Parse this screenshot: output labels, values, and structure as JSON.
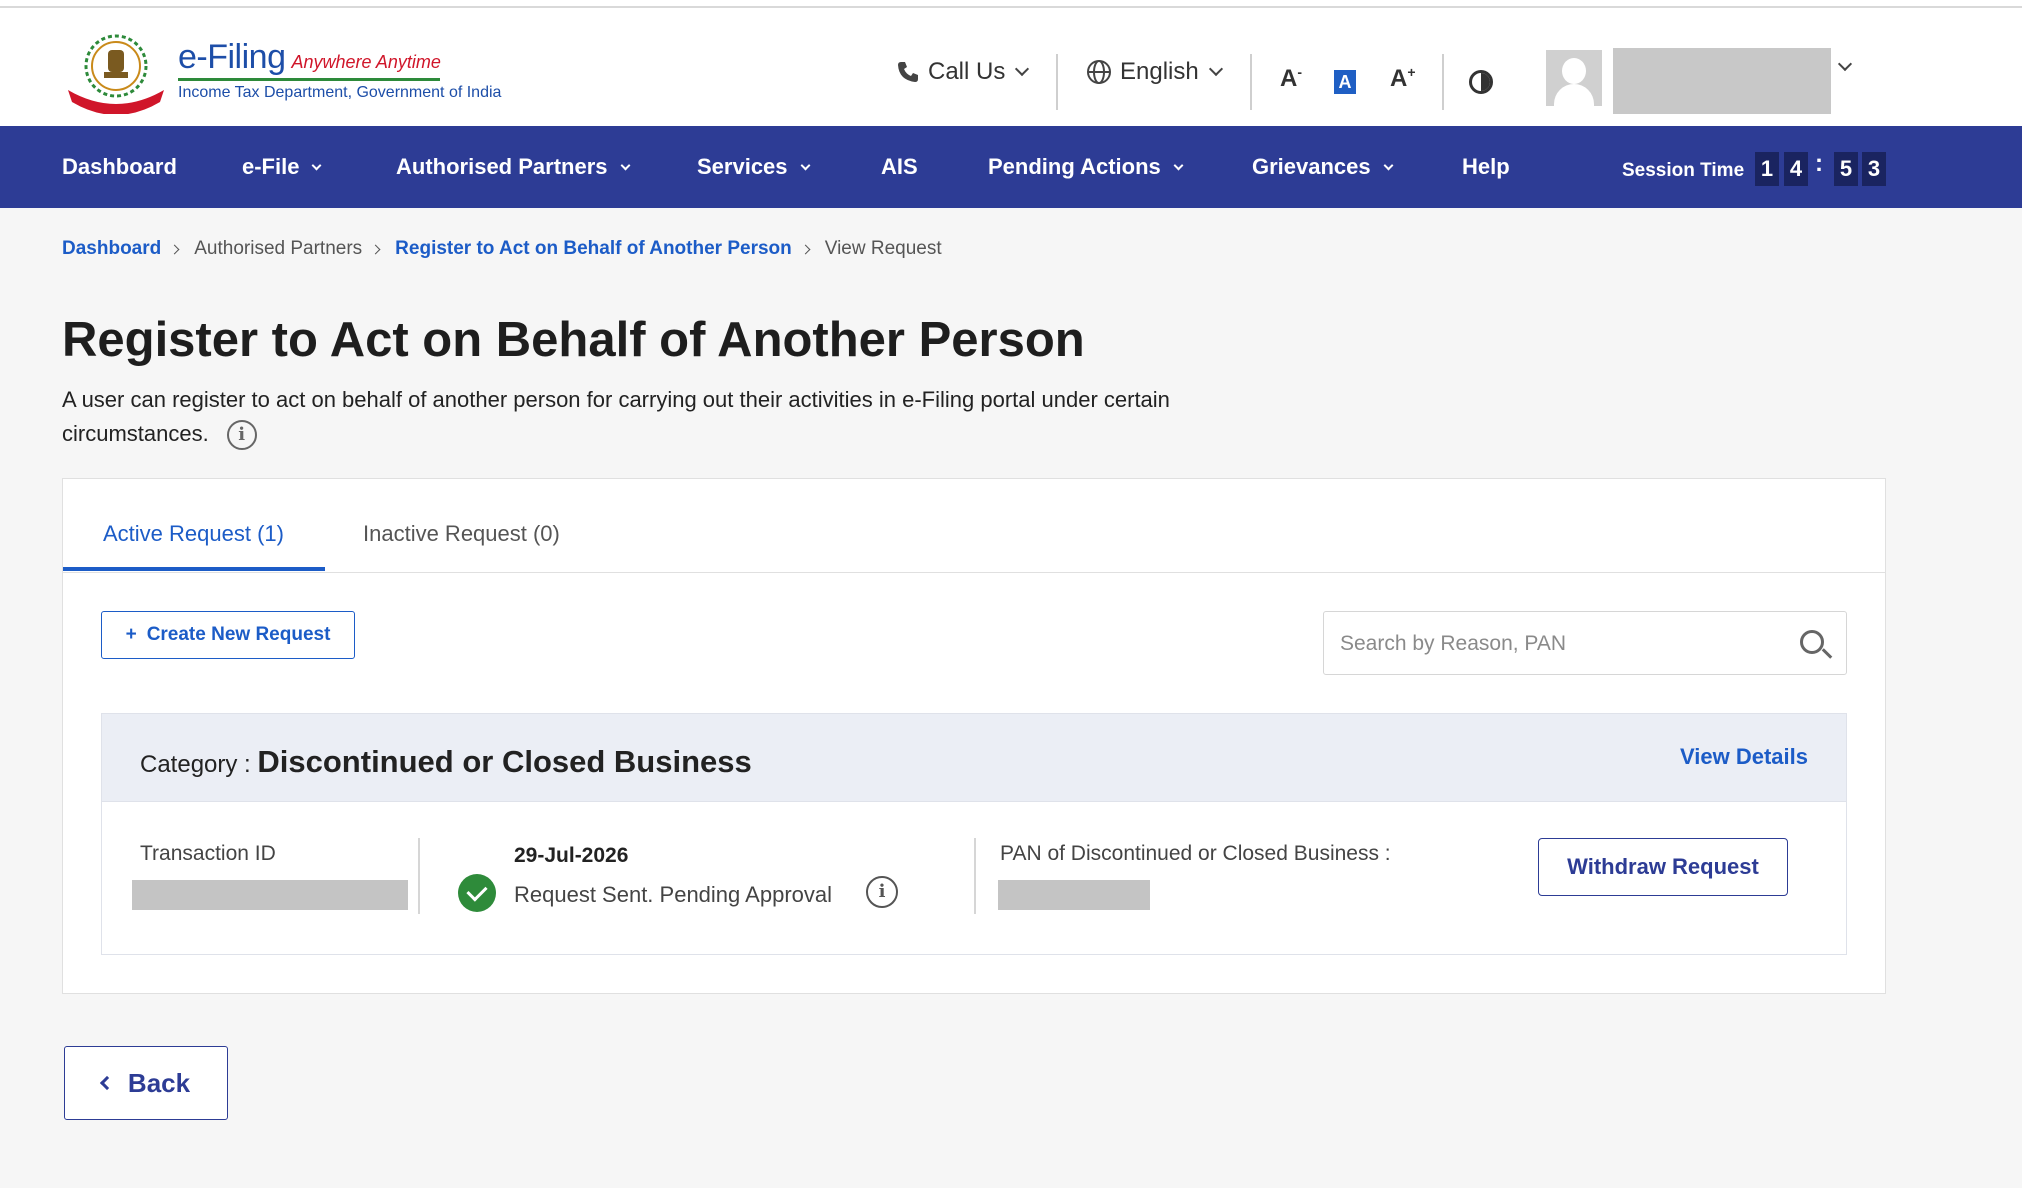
{
  "header": {
    "logo_title": "e-Filing",
    "logo_tagline": "Anywhere Anytime",
    "logo_subtitle": "Income Tax Department, Government of India",
    "call_us": "Call Us",
    "language": "English",
    "font_decrease": "A",
    "font_normal": "A",
    "font_increase": "A"
  },
  "nav": {
    "items": [
      {
        "label": "Dashboard"
      },
      {
        "label": "e-File"
      },
      {
        "label": "Authorised Partners"
      },
      {
        "label": "Services"
      },
      {
        "label": "AIS"
      },
      {
        "label": "Pending Actions"
      },
      {
        "label": "Grievances"
      },
      {
        "label": "Help"
      }
    ],
    "session_label": "Session Time",
    "session_digits": [
      "1",
      "4",
      "5",
      "3"
    ],
    "session_separator": ":"
  },
  "breadcrumb": {
    "items": [
      "Dashboard",
      "Authorised Partners",
      "Register to Act on Behalf of Another Person",
      "View Request"
    ]
  },
  "page": {
    "title": "Register to Act on Behalf of Another Person",
    "description": "A user can register to act on behalf of another person for carrying out their activities in e-Filing portal under certain circumstances.",
    "info_glyph": "i"
  },
  "tabs": {
    "active": "Active Request (1)",
    "inactive": "Inactive Request (0)"
  },
  "actions": {
    "create_label": "Create New Request",
    "create_glyph": "+",
    "search_placeholder": "Search by Reason, PAN",
    "back_label": "Back"
  },
  "request": {
    "category_label": "Category :",
    "category_value": "Discontinued or Closed Business",
    "view_details": "View Details",
    "transaction_label": "Transaction ID",
    "date": "29-Jul-2026",
    "status": "Request Sent. Pending Approval",
    "pan_label": "PAN of Discontinued or Closed Business :",
    "withdraw_label": "Withdraw Request"
  },
  "colors": {
    "nav_bg": "#2d3c95",
    "link": "#1c5cc7",
    "success": "#2e8b3a"
  }
}
